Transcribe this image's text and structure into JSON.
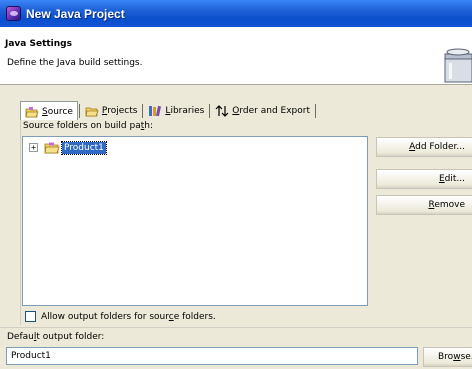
{
  "window": {
    "title": "New Java Project"
  },
  "banner": {
    "heading": "Java Settings",
    "description": "Define the Java build settings."
  },
  "tabs": [
    {
      "id": "source",
      "pre": "",
      "key": "S",
      "post": "ource",
      "icon": "source-folder-icon",
      "active": true
    },
    {
      "id": "projects",
      "pre": "",
      "key": "P",
      "post": "rojects",
      "icon": "project-icon",
      "active": false
    },
    {
      "id": "libraries",
      "pre": "",
      "key": "L",
      "post": "ibraries",
      "icon": "library-books-icon",
      "active": false
    },
    {
      "id": "order",
      "pre": "",
      "key": "O",
      "post": "rder and Export",
      "icon": "sort-arrows-icon",
      "active": false
    }
  ],
  "source_folders": {
    "label_pre": "Source folders on build pa",
    "label_key": "t",
    "label_post": "h:",
    "items": [
      {
        "label": "Product1",
        "expander": "+",
        "selected": true
      }
    ]
  },
  "buttons": {
    "add_folder": {
      "pre": "",
      "key": "A",
      "post": "dd Folder..."
    },
    "edit": {
      "pre": "",
      "key": "E",
      "post": "dit..."
    },
    "remove": {
      "pre": "",
      "key": "R",
      "post": "emove"
    }
  },
  "allow_output": {
    "pre": "Allow output folders for sour",
    "key": "c",
    "post": "e folders.",
    "checked": false
  },
  "output_folder": {
    "label_pre": "Defau",
    "label_key": "l",
    "label_post": "t output folder:",
    "value": "Product1",
    "browse_pre": "Bro",
    "browse_key": "w",
    "browse_post": "se..."
  }
}
